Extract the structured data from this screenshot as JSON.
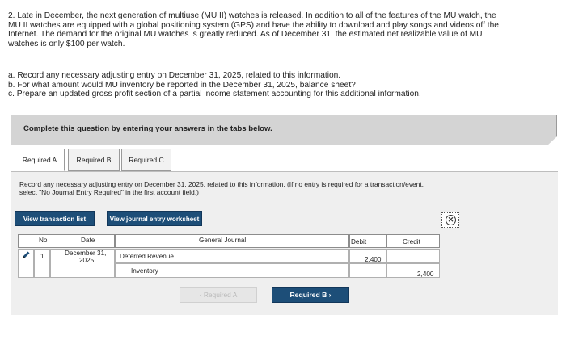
{
  "problem": {
    "lines": [
      "2. Late in December, the next generation of multiuse (MU II) watches is released. In addition to all of the features of the MU watch, the",
      "MU II watches are equipped with a global positioning system (GPS) and have the ability to download and play songs and videos off the",
      "Internet. The demand for the original MU watches is greatly reduced. As of December 31, the estimated net realizable value of MU",
      "watches is only $100 per watch."
    ],
    "parts": [
      "a. Record any necessary adjusting entry on December 31, 2025, related to this information.",
      "b. For what amount would MU inventory be reported in the December 31, 2025, balance sheet?",
      "c. Prepare an updated gross profit section of a partial income statement accounting for this additional information."
    ]
  },
  "banner": {
    "text": "Complete this question by entering your answers in the tabs below."
  },
  "tabs": [
    {
      "label": "Required A"
    },
    {
      "label": "Required B"
    },
    {
      "label": "Required C"
    }
  ],
  "instructions": {
    "line1": "Record any necessary adjusting entry on December 31, 2025, related to this information. (If no entry is required for a transaction/event,",
    "line2": "select \"No Journal Entry Required\" in the first account field.)"
  },
  "buttons": {
    "view_transaction_list": "View transaction list",
    "view_journal_worksheet": "View journal entry worksheet"
  },
  "table": {
    "headers": {
      "no": "No",
      "date": "Date",
      "general_journal": "General Journal",
      "debit": "Debit",
      "credit": "Credit"
    },
    "entry": {
      "no": "1",
      "date_line1": "December 31,",
      "date_line2": "2025",
      "debit_account": "Deferred Revenue",
      "debit_amount": "2,400",
      "credit_account": "Inventory",
      "credit_amount": "2,400"
    }
  },
  "nav": {
    "prev": "Required A",
    "next": "Required B"
  },
  "icons": {
    "edit": "pencil-icon",
    "close": "close-circle-icon"
  },
  "colors": {
    "accent": "#1d4e78",
    "banner": "#d4d4d4",
    "panel": "#efefef"
  }
}
